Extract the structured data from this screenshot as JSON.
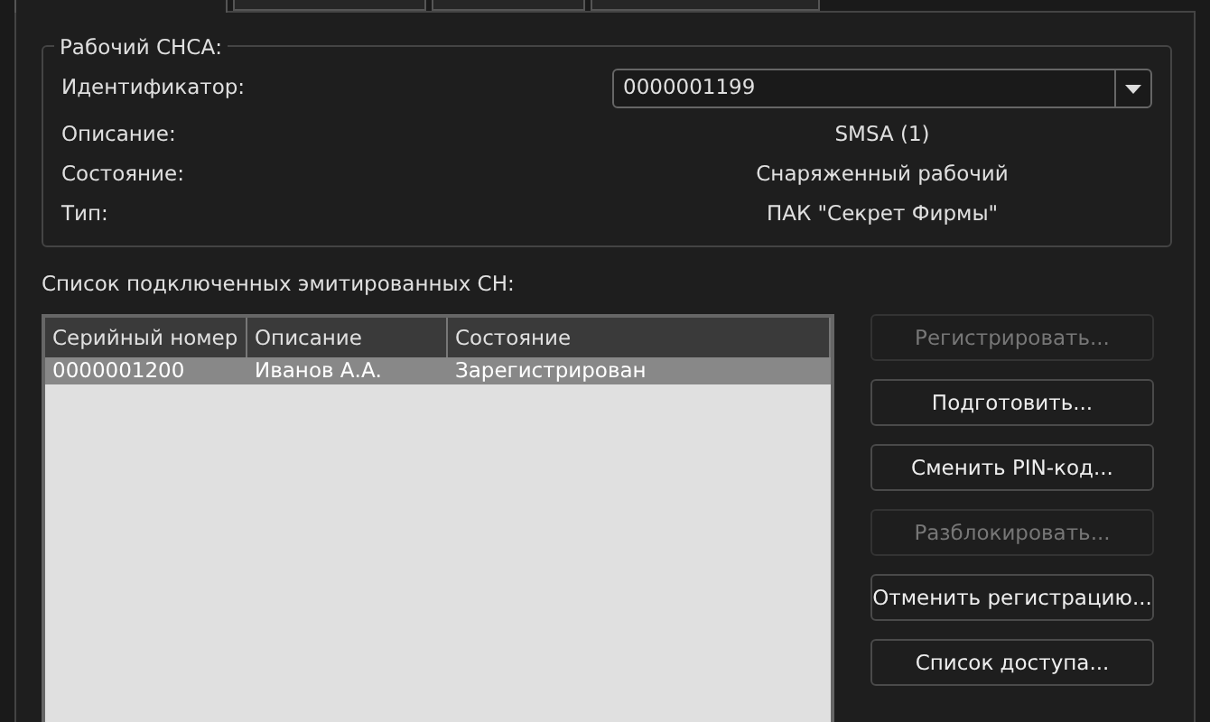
{
  "tabs": [
    {
      "selected": true
    },
    {
      "selected": false
    },
    {
      "selected": false
    },
    {
      "selected": false
    }
  ],
  "group": {
    "title": "Рабочий СНСА:",
    "fields": [
      {
        "kind": "combo",
        "label": "Идентификатор:",
        "value": "0000001199"
      },
      {
        "kind": "text",
        "label": "Описание:",
        "value": "SMSA (1)"
      },
      {
        "kind": "text",
        "label": "Состояние:",
        "value": "Снаряженный рабочий"
      },
      {
        "kind": "text",
        "label": "Тип:",
        "value": "ПАК \"Секрет Фирмы\""
      }
    ]
  },
  "list_label": "Список подключенных эмитированных СН:",
  "table": {
    "columns": [
      "Серийный номер",
      "Описание",
      "Состояние"
    ],
    "rows": [
      {
        "cells": [
          "0000001200",
          "Иванов А.А.",
          "Зарегистрирован"
        ],
        "selected": true
      }
    ]
  },
  "buttons": [
    {
      "label": "Регистрировать...",
      "disabled": true
    },
    {
      "label": "Подготовить...",
      "disabled": false
    },
    {
      "label": "Сменить PIN-код...",
      "disabled": false
    },
    {
      "label": "Разблокировать...",
      "disabled": true
    },
    {
      "label": "Отменить регистрацию...",
      "disabled": false
    },
    {
      "label": "Список доступа...",
      "disabled": false
    }
  ]
}
